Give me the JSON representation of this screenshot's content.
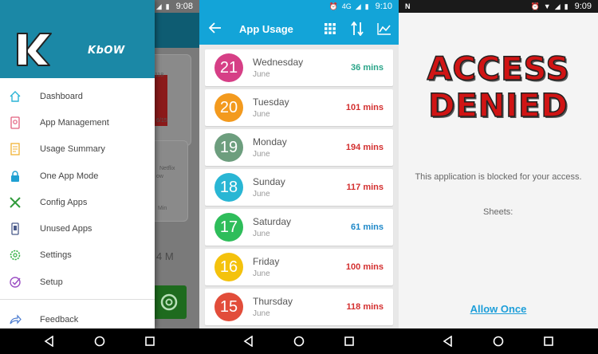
{
  "panel1": {
    "time": "9:08",
    "network": "4G",
    "brand": "KbOW",
    "menu": [
      {
        "label": "Dashboard",
        "icon": "house-icon"
      },
      {
        "label": "App Management",
        "icon": "app-management-icon"
      },
      {
        "label": "Usage Summary",
        "icon": "document-icon"
      },
      {
        "label": "One App Mode",
        "icon": "lock-icon"
      },
      {
        "label": "Config Apps",
        "icon": "tools-icon"
      },
      {
        "label": "Unused Apps",
        "icon": "phone-icon"
      },
      {
        "label": "Settings",
        "icon": "gear-icon"
      },
      {
        "label": "Setup",
        "icon": "check-circle-icon"
      }
    ],
    "feedback": {
      "label": "Feedback",
      "icon": "share-arrow-icon"
    },
    "background": {
      "ghost_118": "118",
      "ghost_date": "6/15",
      "ghost_netflix": "Netflix",
      "ghost_ow": "ow",
      "ghost_min": "Min",
      "ghost_4m": "4 M"
    }
  },
  "panel2": {
    "time": "9:10",
    "network": "4G",
    "title": "App Usage",
    "days": [
      {
        "day": "21",
        "name": "Wednesday",
        "month": "June",
        "mins": "36 mins",
        "circle": "#d63f86",
        "mins_color": "#2aa589"
      },
      {
        "day": "20",
        "name": "Tuesday",
        "month": "June",
        "mins": "101 mins",
        "circle": "#f39a1e",
        "mins_color": "#d32f2f"
      },
      {
        "day": "19",
        "name": "Monday",
        "month": "June",
        "mins": "194 mins",
        "circle": "#6d9e7e",
        "mins_color": "#d32f2f"
      },
      {
        "day": "18",
        "name": "Sunday",
        "month": "June",
        "mins": "117 mins",
        "circle": "#29b6d4",
        "mins_color": "#d32f2f"
      },
      {
        "day": "17",
        "name": "Saturday",
        "month": "June",
        "mins": "61 mins",
        "circle": "#2ebd5a",
        "mins_color": "#1e88c8"
      },
      {
        "day": "16",
        "name": "Friday",
        "month": "June",
        "mins": "100 mins",
        "circle": "#f4c20d",
        "mins_color": "#d32f2f"
      },
      {
        "day": "15",
        "name": "Thursday",
        "month": "June",
        "mins": "118 mins",
        "circle": "#e24d3a",
        "mins_color": "#d32f2f"
      }
    ]
  },
  "panel3": {
    "time": "9:09",
    "headline_line1": "ACCESS",
    "headline_line2": "DENIED",
    "message": "This application is blocked for your access.",
    "sheets_label": "Sheets:",
    "allow_once": "Allow Once"
  },
  "colors": {
    "primary": "#13a4d8",
    "drawer_header": "#1b88a6",
    "denied_red": "#d01414",
    "link_blue": "#1d9ed9"
  }
}
